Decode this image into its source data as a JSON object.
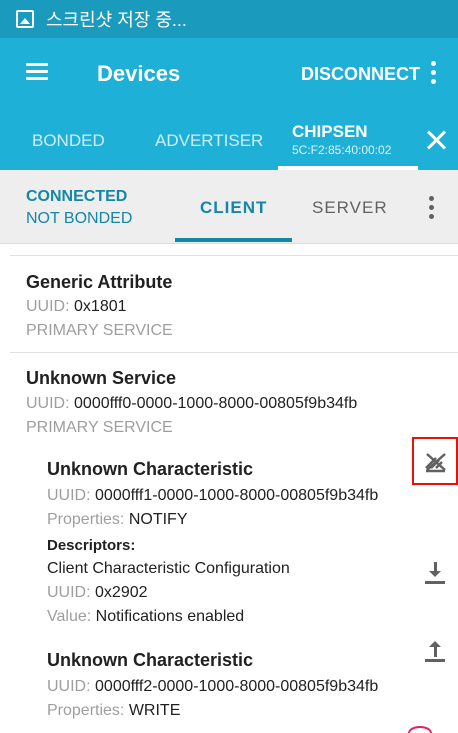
{
  "status_bar": {
    "text": "스크린샷 저장 중..."
  },
  "app_bar": {
    "title": "Devices",
    "disconnect_label": "DISCONNECT"
  },
  "device_tabs": {
    "bonded": "BONDED",
    "advertiser": "ADVERTISER",
    "chipsen_name": "CHIPSEN",
    "chipsen_address": "5C:F2:85:40:00:02"
  },
  "connection": {
    "state": "CONNECTED",
    "bond_state": "NOT BONDED"
  },
  "sub_tabs": {
    "client": "CLIENT",
    "server": "SERVER"
  },
  "labels": {
    "uuid": "UUID:",
    "properties": "Properties:",
    "descriptors": "Descriptors:",
    "value": "Value:"
  },
  "services": [
    {
      "name": "Generic Attribute",
      "uuid": "0x1801",
      "type": "PRIMARY SERVICE"
    },
    {
      "name": "Unknown Service",
      "uuid": "0000fff0-0000-1000-8000-00805f9b34fb",
      "type": "PRIMARY SERVICE",
      "characteristics": [
        {
          "name": "Unknown Characteristic",
          "uuid": "0000fff1-0000-1000-8000-00805f9b34fb",
          "properties": "NOTIFY",
          "action_icon": "notifications-off-icon",
          "descriptors": [
            {
              "name": "Client Characteristic Configuration",
              "uuid": "0x2902",
              "value": "Notifications enabled",
              "action_icon": "download-icon"
            }
          ]
        },
        {
          "name": "Unknown Characteristic",
          "uuid": "0000fff2-0000-1000-8000-00805f9b34fb",
          "properties": "WRITE",
          "action_icon": "upload-icon"
        }
      ]
    }
  ],
  "colors": {
    "primary": "#1fb0d8",
    "status_bar": "#1a9bbd",
    "accent": "#1486a8",
    "highlight": "#e3120b"
  }
}
